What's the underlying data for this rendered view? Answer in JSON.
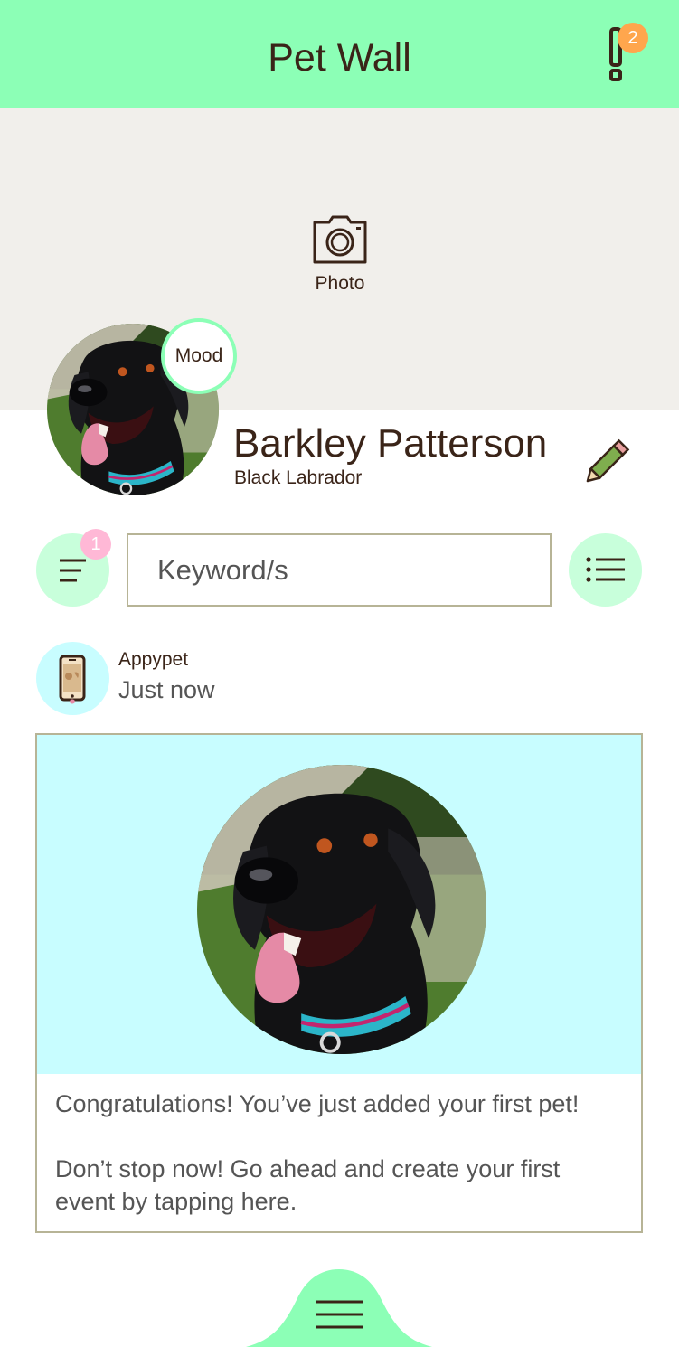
{
  "header": {
    "title": "Pet Wall",
    "notifications_count": "2",
    "alert_icon": "exclamation-icon",
    "background_color": "#8cffb6"
  },
  "cover": {
    "photo_label": "Photo",
    "camera_icon": "camera-icon",
    "background_color": "#f1efeb"
  },
  "pet": {
    "mood_label": "Mood",
    "name": "Barkley Patterson",
    "breed": "Black Labrador",
    "edit_icon": "pencil-icon"
  },
  "search": {
    "filter_count": "1",
    "placeholder": "Keyword/s",
    "value": "",
    "filter_icon": "filter-lines-icon",
    "list_icon": "bulleted-list-icon"
  },
  "post": {
    "author": "Appypet",
    "time": "Just now",
    "author_icon": "phone-pet-icon",
    "message_line1": "Congratulations! You’ve just added your first pet!",
    "message_line2": "Don’t stop now! Go ahead and create your first event by tapping here.",
    "media_background": "#c8fdff"
  },
  "footer": {
    "menu_icon": "hamburger-menu-icon"
  },
  "colors": {
    "accent_green": "#8cffb6",
    "light_green": "#c8ffdb",
    "badge_orange": "#ffa64d",
    "badge_pink": "#ffb8d6",
    "text_brown": "#3a2418"
  }
}
